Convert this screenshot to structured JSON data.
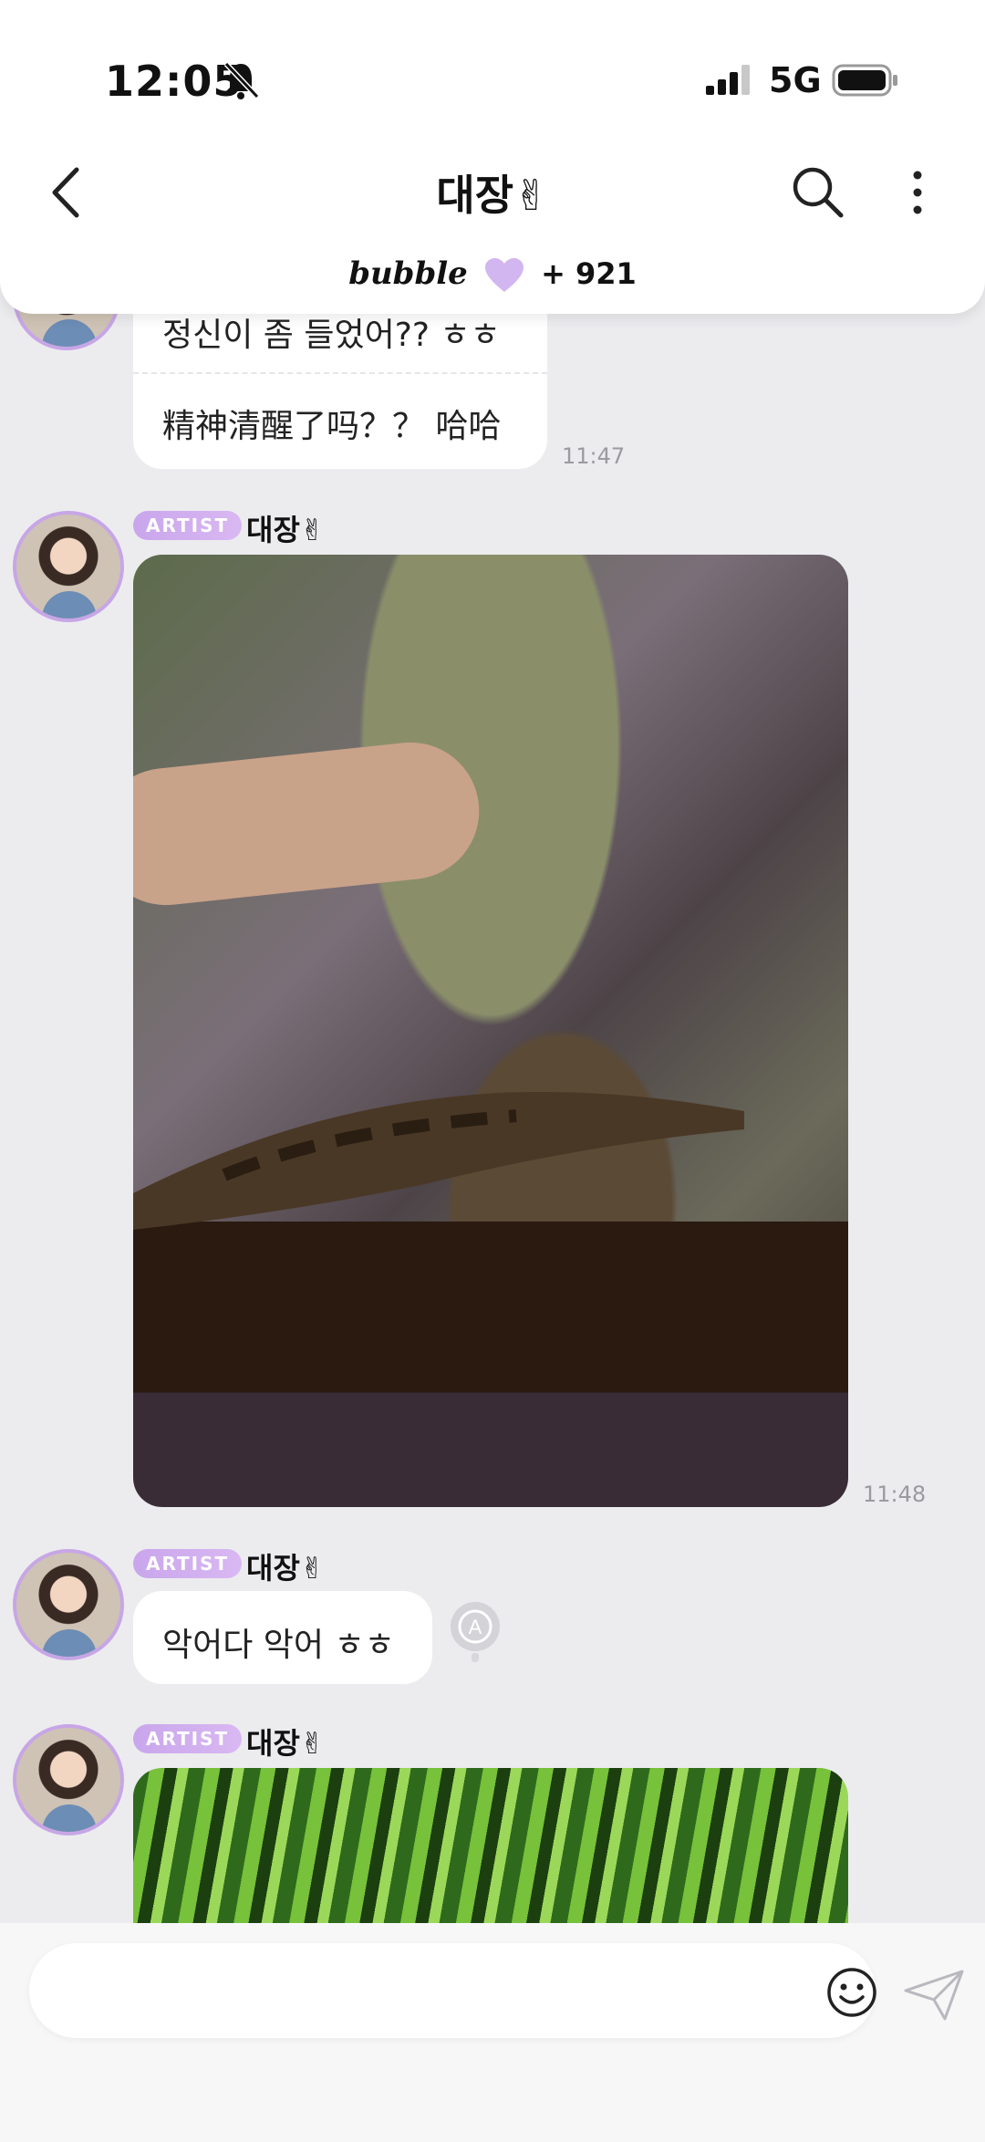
{
  "status_bar": {
    "time": "12:05",
    "network": "5G"
  },
  "header": {
    "title": "대장✌",
    "bubble_label": "bubble",
    "bubble_count": "+ 921"
  },
  "messages": {
    "m1": {
      "line_ko": "정신이 좀 들었어?? ㅎㅎ",
      "line_zh": "精神清醒了吗？？ 哈哈",
      "time": "11:47"
    },
    "m2": {
      "tag": "ARTIST",
      "sender": "대장✌",
      "time": "11:48"
    },
    "m3": {
      "tag": "ARTIST",
      "sender": "대장✌",
      "text": "악어다 악어 ㅎㅎ"
    },
    "m4": {
      "tag": "ARTIST",
      "sender": "대장✌"
    }
  },
  "composer": {
    "placeholder": ""
  },
  "colors": {
    "accent": "#c9a6ec",
    "background": "#ececef"
  },
  "icons": [
    "bell-slash-icon",
    "signal-icon",
    "battery-icon",
    "back-icon",
    "search-icon",
    "more-icon",
    "heart-icon",
    "translate-icon",
    "smile-icon",
    "send-icon"
  ]
}
